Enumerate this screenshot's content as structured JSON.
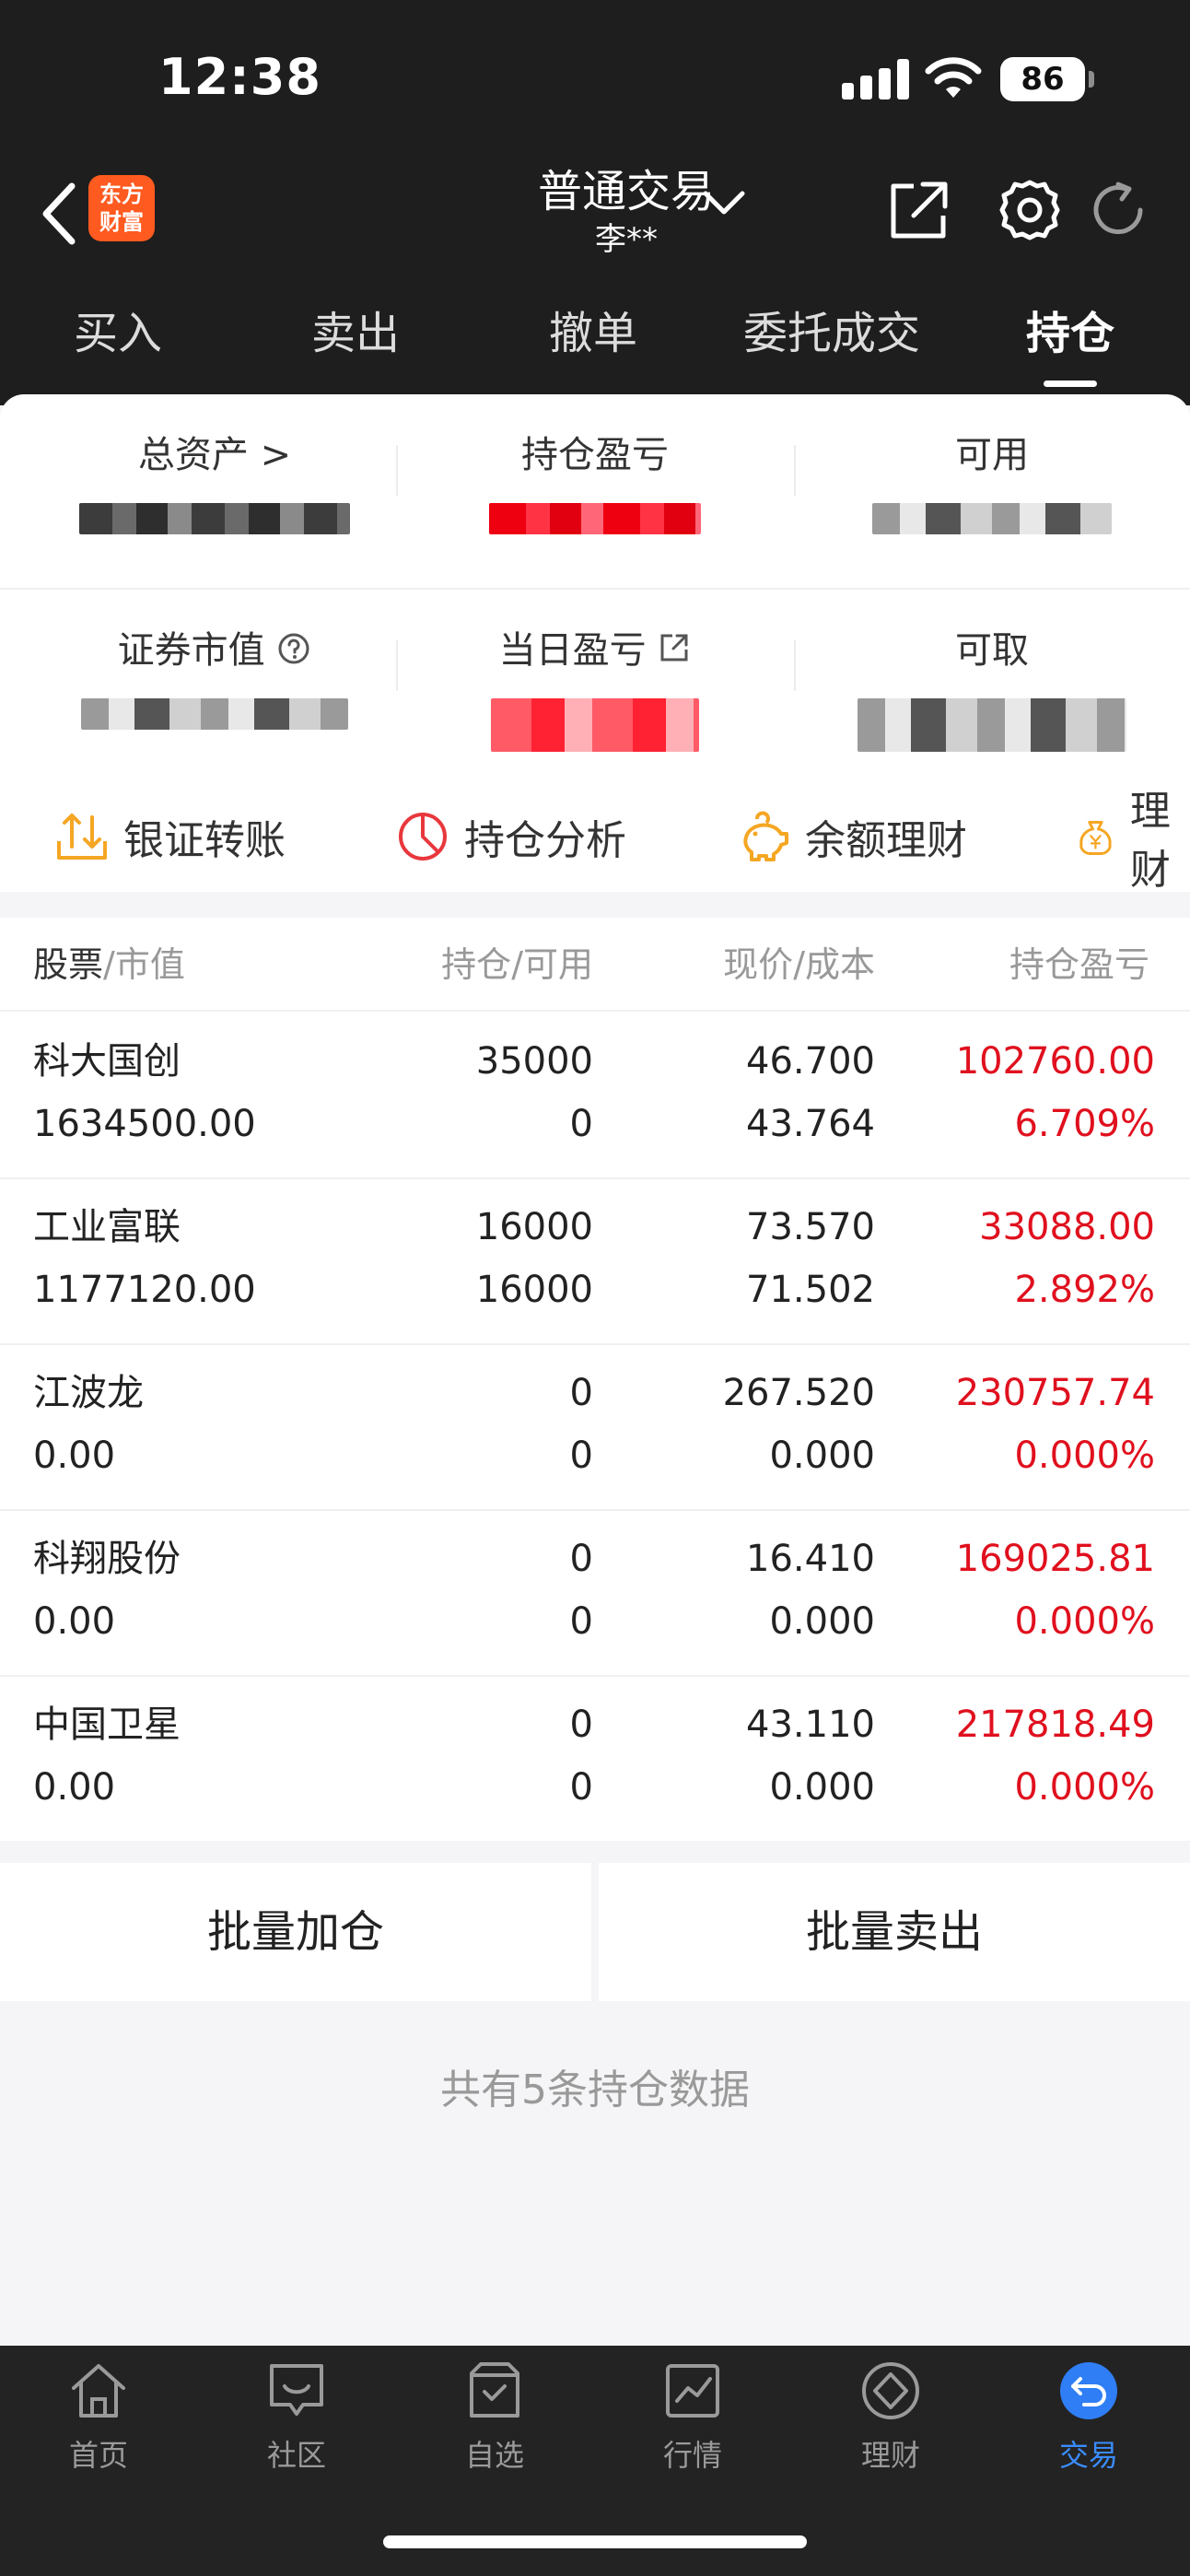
{
  "status_bar": {
    "time": "12:38",
    "battery": "86"
  },
  "nav": {
    "logo_line1": "东方",
    "logo_line2": "财富",
    "title": "普通交易",
    "account": "李**",
    "icons": [
      "share-icon",
      "gear-icon",
      "refresh-icon"
    ]
  },
  "tabs": [
    "买入",
    "卖出",
    "撤单",
    "委托成交",
    "持仓"
  ],
  "active_tab": "持仓",
  "summary": {
    "total_assets_label": "总资产 >",
    "position_pl_label": "持仓盈亏",
    "available_label": "可用",
    "market_value_label": "证券市值",
    "daily_pl_label": "当日盈亏",
    "withdrawable_label": "可取"
  },
  "quick_actions": [
    "银证转账",
    "持仓分析",
    "余额理财",
    "理财"
  ],
  "table": {
    "headers": {
      "col0_main": "股票",
      "col0_sub": "/市值",
      "col1_main": "持仓",
      "col1_sub": "/可用",
      "col2_main": "现价",
      "col2_sub": "/成本",
      "col3_main": "持仓盈亏"
    },
    "rows": [
      {
        "name": "科大国创",
        "market_value": "1634500.00",
        "position": "35000",
        "available": "0",
        "price": "46.700",
        "cost": "43.764",
        "pl": "102760.00",
        "pl_pct": "6.709%"
      },
      {
        "name": "工业富联",
        "market_value": "1177120.00",
        "position": "16000",
        "available": "16000",
        "price": "73.570",
        "cost": "71.502",
        "pl": "33088.00",
        "pl_pct": "2.892%"
      },
      {
        "name": "江波龙",
        "market_value": "0.00",
        "position": "0",
        "available": "0",
        "price": "267.520",
        "cost": "0.000",
        "pl": "230757.74",
        "pl_pct": "0.000%"
      },
      {
        "name": "科翔股份",
        "market_value": "0.00",
        "position": "0",
        "available": "0",
        "price": "16.410",
        "cost": "0.000",
        "pl": "169025.81",
        "pl_pct": "0.000%"
      },
      {
        "name": "中国卫星",
        "market_value": "0.00",
        "position": "0",
        "available": "0",
        "price": "43.110",
        "cost": "0.000",
        "pl": "217818.49",
        "pl_pct": "0.000%"
      }
    ]
  },
  "actions": {
    "batch_add": "批量加仓",
    "batch_sell": "批量卖出"
  },
  "footer_note": "共有5条持仓数据",
  "bottom_tabs": [
    {
      "label": "首页",
      "icon": "home-icon"
    },
    {
      "label": "社区",
      "icon": "chat-icon"
    },
    {
      "label": "自选",
      "icon": "watchlist-icon"
    },
    {
      "label": "行情",
      "icon": "chart-icon"
    },
    {
      "label": "理财",
      "icon": "diamond-icon"
    },
    {
      "label": "交易",
      "icon": "trade-icon"
    }
  ],
  "colors": {
    "profit_red": "#e0101e",
    "active_blue": "#3a8cff",
    "header_bg": "#1e1e1e"
  }
}
